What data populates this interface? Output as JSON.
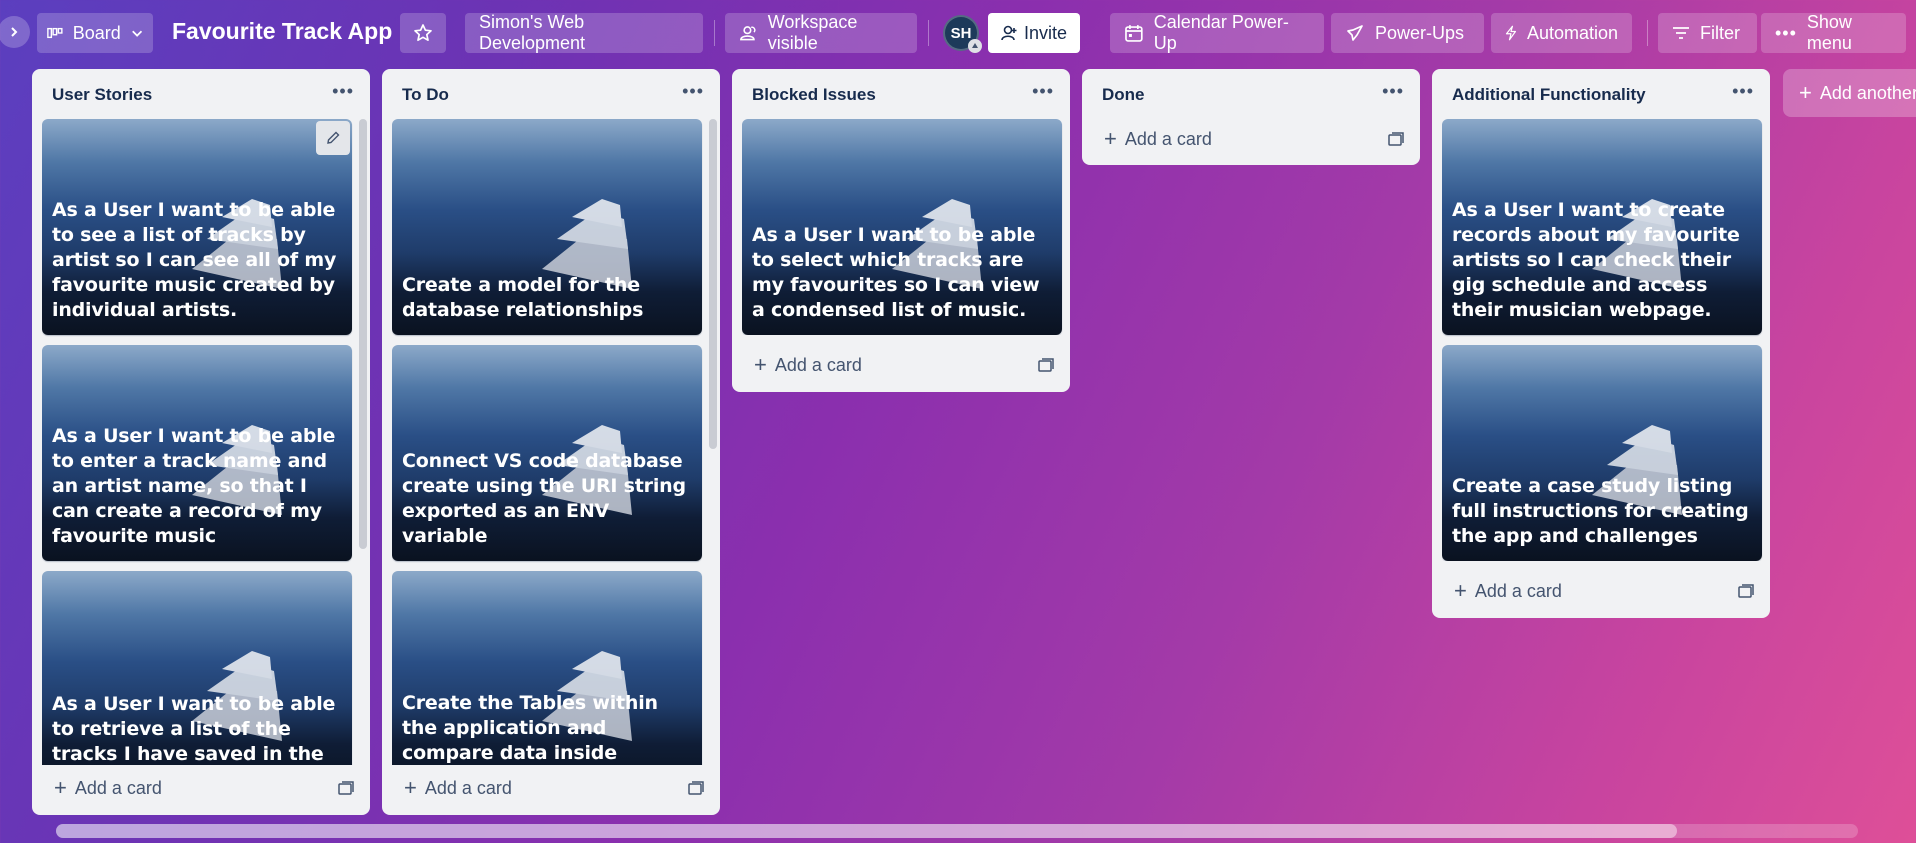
{
  "header": {
    "view_switcher": "Board",
    "board_title": "Favourite Track App",
    "workspace": "Simon's Web Development",
    "visibility": "Workspace visible",
    "avatar_initials": "SH",
    "invite": "Invite",
    "calendar": "Calendar Power-Up",
    "power_ups": "Power-Ups",
    "automation": "Automation",
    "filter": "Filter",
    "show_menu": "Show menu"
  },
  "lists": [
    {
      "title": "User Stories",
      "cards": [
        "As a User I want to be able to see a list of tracks by artist so I can see all of my favourite music created by individual artists.",
        "As a User I want to be able to enter a track name and an artist name, so that I can create a record of my favourite music",
        "As a User I want to be able to retrieve a list of the tracks I have saved in the database, so I can view them."
      ],
      "add_card": "Add a card"
    },
    {
      "title": "To Do",
      "cards": [
        "Create a model for the database relationships",
        "Connect VS code database create using the URI string exported as an ENV variable",
        "Create the Tables within the application and compare data inside workbench using queries"
      ],
      "add_card": "Add a card"
    },
    {
      "title": "Blocked Issues",
      "cards": [
        "As a User I want to be able to select which tracks are my favourites so I can view a condensed list of music."
      ],
      "add_card": "Add a card"
    },
    {
      "title": "Done",
      "cards": [],
      "add_card": "Add a card"
    },
    {
      "title": "Additional Functionality",
      "cards": [
        "As a User I want to create records about my favourite artists so I can check their gig schedule and access their musician webpage.",
        "Create a case study listing full instructions for creating the app and challenges"
      ],
      "add_card": "Add a card"
    }
  ],
  "add_list": "Add another list"
}
